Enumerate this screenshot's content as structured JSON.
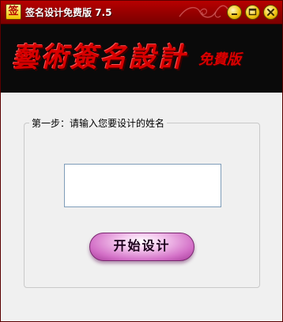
{
  "window": {
    "title": "签名设计免费版 7.5",
    "icon_glyph": "签",
    "icon_name": "app-signature-icon",
    "controls": {
      "minimize_icon": "minimize-icon",
      "maximize_icon": "maximize-icon",
      "close_icon": "close-icon"
    },
    "colors": {
      "titlebar": "#9a0000",
      "banner_bg": "#0a0a0a",
      "banner_text": "#d80000",
      "button_accent": "#d472c8"
    }
  },
  "banner": {
    "title": "藝術簽名設計",
    "subtitle": "免費版"
  },
  "form": {
    "step_label": "第一步：请输入您要设计的姓名",
    "name_value": "",
    "start_button_label": "开始设计"
  }
}
